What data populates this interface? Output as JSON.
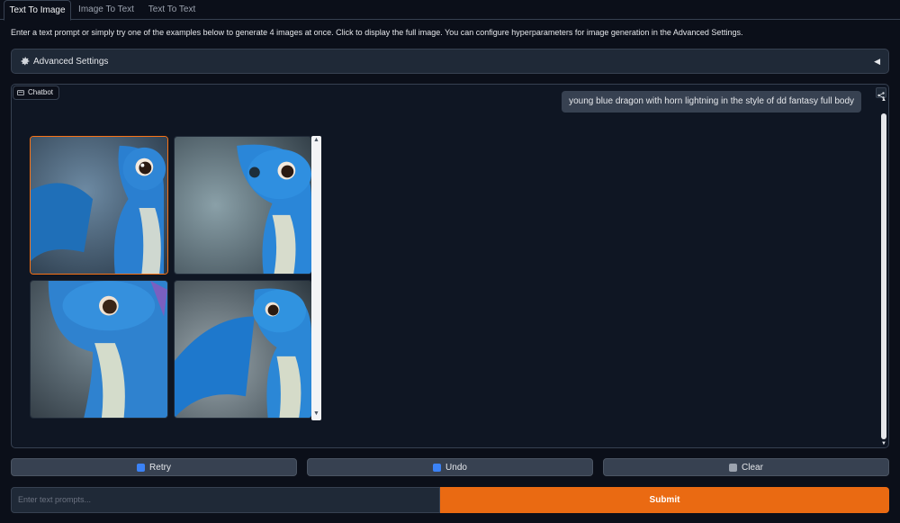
{
  "tabs": [
    {
      "label": "Text To Image",
      "active": true
    },
    {
      "label": "Image To Text",
      "active": false
    },
    {
      "label": "Text To Text",
      "active": false
    }
  ],
  "intro": "Enter a text prompt or simply try one of the examples below to generate 4 images at once. Click to display the full image. You can configure hyperparameters for image generation in the Advanced Settings.",
  "advanced": {
    "label": "Advanced Settings",
    "icon": "gear-icon",
    "arrow": "◀"
  },
  "chatbot": {
    "label": "Chatbot",
    "user_message": "young blue dragon with horn lightning in the style of dd fantasy full body",
    "images": [
      {
        "name": "generated-image-1",
        "selected": true
      },
      {
        "name": "generated-image-2",
        "selected": false
      },
      {
        "name": "generated-image-3",
        "selected": false
      },
      {
        "name": "generated-image-4",
        "selected": false
      }
    ]
  },
  "buttons": {
    "retry": "Retry",
    "undo": "Undo",
    "clear": "Clear"
  },
  "input": {
    "placeholder": "Enter text prompts..."
  },
  "submit": "Submit",
  "colors": {
    "accent": "#ea6a12",
    "selected_border": "#f97316",
    "background": "#0b0f19"
  }
}
